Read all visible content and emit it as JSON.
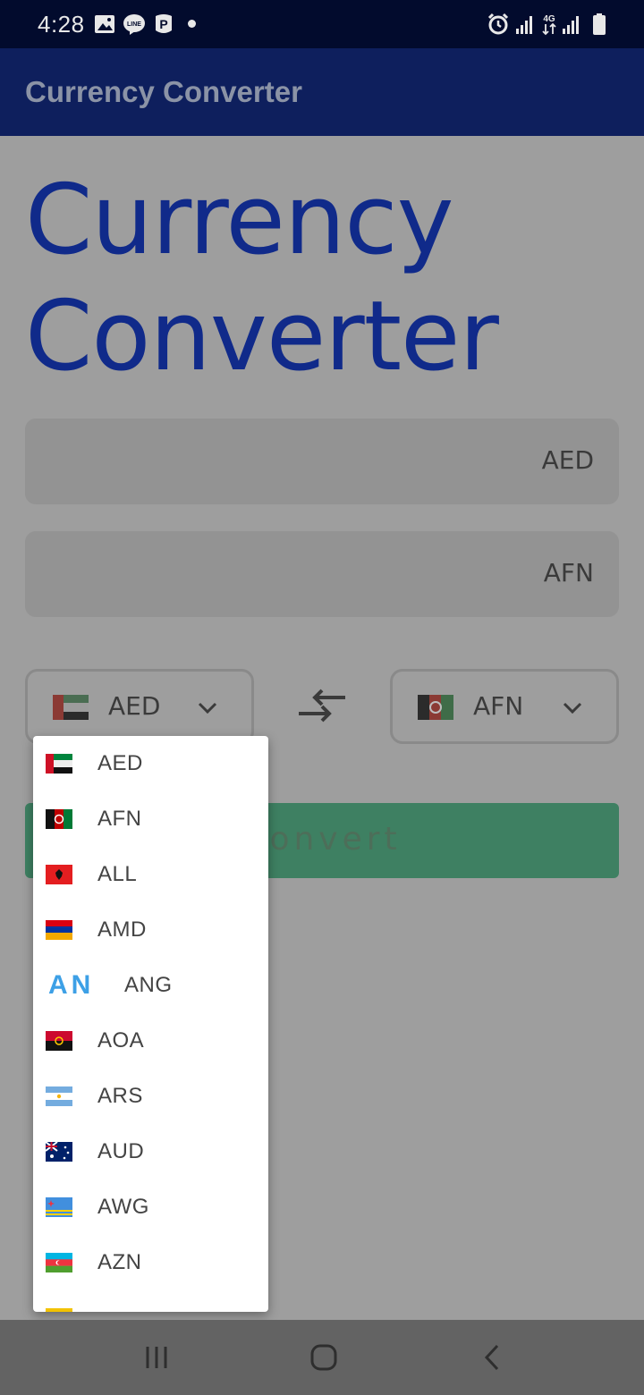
{
  "status_bar": {
    "time": "4:28",
    "icons": [
      "gallery-icon",
      "line-icon",
      "p-icon",
      "dot-icon",
      "alarm-icon",
      "signal-icon",
      "4g-icon",
      "signal-icon",
      "battery-icon"
    ],
    "network": "4G"
  },
  "app_bar": {
    "title": "Currency Converter"
  },
  "main": {
    "heading_line1": "Currency",
    "heading_line2": "Converter",
    "from_amount_currency": "AED",
    "to_amount_currency": "AFN",
    "from_select": {
      "code": "AED",
      "flag_icon": "uae-flag-icon"
    },
    "to_select": {
      "code": "AFN",
      "flag_icon": "afghanistan-flag-icon"
    },
    "swap_icon": "swap-arrows-icon",
    "convert_label": "Convert"
  },
  "dropdown": {
    "items": [
      {
        "code": "AED",
        "flag": "uae-flag-icon"
      },
      {
        "code": "AFN",
        "flag": "afghanistan-flag-icon"
      },
      {
        "code": "ALL",
        "flag": "albania-flag-icon"
      },
      {
        "code": "AMD",
        "flag": "armenia-flag-icon"
      },
      {
        "code": "ANG",
        "flag": "an-text-icon",
        "flag_text": "AN"
      },
      {
        "code": "AOA",
        "flag": "angola-flag-icon"
      },
      {
        "code": "ARS",
        "flag": "argentina-flag-icon"
      },
      {
        "code": "AUD",
        "flag": "australia-flag-icon"
      },
      {
        "code": "AWG",
        "flag": "aruba-flag-icon"
      },
      {
        "code": "AZN",
        "flag": "azerbaijan-flag-icon"
      }
    ]
  },
  "nav_bar": {
    "icons": [
      "recent-apps-icon",
      "home-icon",
      "back-icon"
    ]
  },
  "colors": {
    "status_bar": "#020b2d",
    "app_bar": "#0e1f5d",
    "heading": "#102a8a",
    "convert_button": "#3e8062",
    "scrim_background": "#9e9e9e"
  }
}
